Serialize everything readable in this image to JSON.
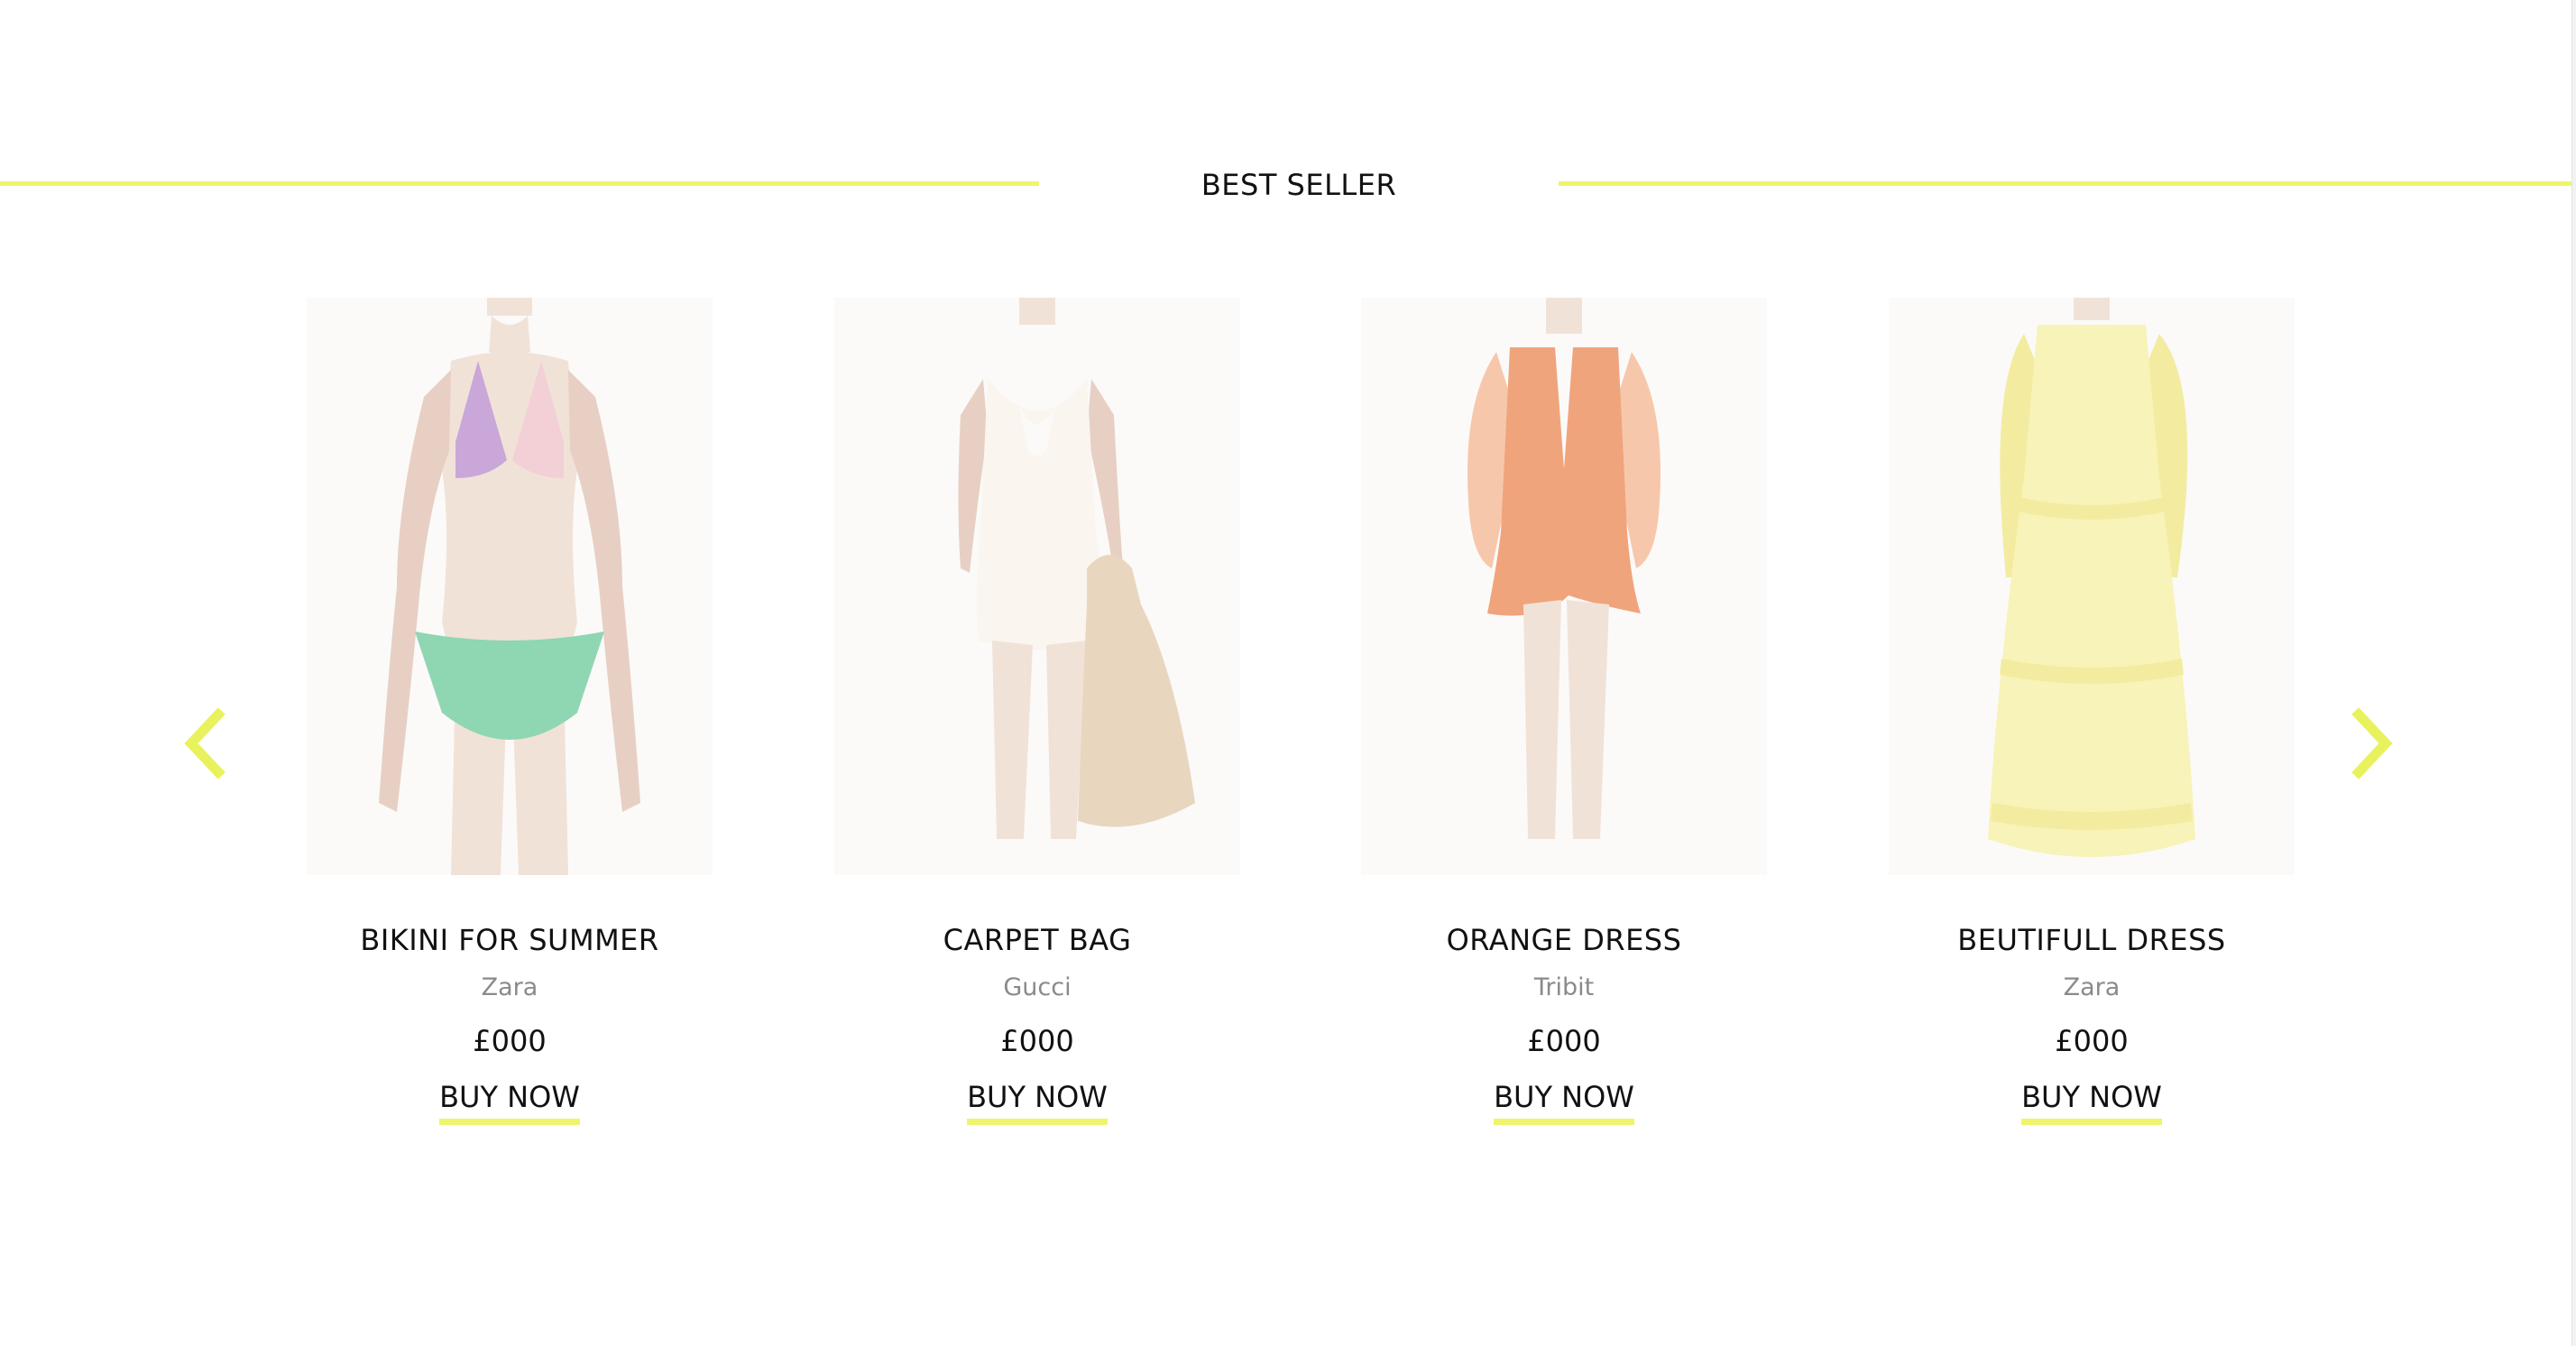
{
  "colors": {
    "accent": "#eef56a",
    "arrow": "#e8f25c",
    "image_bg": "#fbfaf9",
    "skin": "#f1e2d8",
    "skin_shade": "#e7d0c3"
  },
  "section": {
    "title": "BEST SELLER"
  },
  "carousel": {
    "prev_icon": "chevron-left-icon",
    "next_icon": "chevron-right-icon"
  },
  "products": [
    {
      "title": "BIKINI FOR SUMMER",
      "brand": "Zara",
      "price": "£000",
      "cta": "BUY NOW",
      "image_icon": "bikini-model-image",
      "garment_colors": [
        "#c9a7d9",
        "#f3cfd6",
        "#8fd6b3"
      ]
    },
    {
      "title": "CARPET BAG",
      "brand": "Gucci",
      "price": "£000",
      "cta": "BUY NOW",
      "image_icon": "white-dress-bag-model-image",
      "garment_colors": [
        "#faf6ef",
        "#e8d6bf"
      ]
    },
    {
      "title": "ORANGE DRESS",
      "brand": "Tribit",
      "price": "£000",
      "cta": "BUY NOW",
      "image_icon": "orange-dress-model-image",
      "garment_colors": [
        "#f0a47c",
        "#f7c7ab"
      ]
    },
    {
      "title": "BEUTIFULL DRESS",
      "brand": "Zara",
      "price": "£000",
      "cta": "BUY NOW",
      "image_icon": "yellow-dress-model-image",
      "garment_colors": [
        "#f8f3b8",
        "#f3eca0"
      ]
    }
  ]
}
